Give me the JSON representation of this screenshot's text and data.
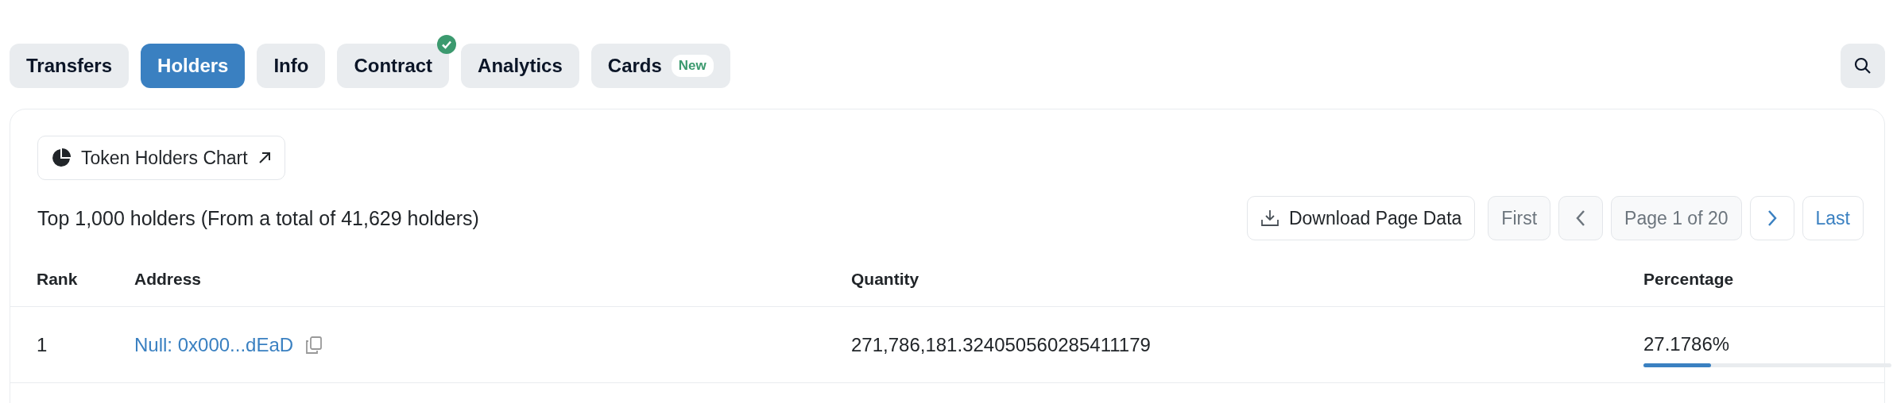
{
  "tabs": [
    {
      "label": "Transfers",
      "selected": false,
      "verified": false
    },
    {
      "label": "Holders",
      "selected": true,
      "verified": false
    },
    {
      "label": "Info",
      "selected": false,
      "verified": false
    },
    {
      "label": "Contract",
      "selected": false,
      "verified": true
    },
    {
      "label": "Analytics",
      "selected": false,
      "verified": false
    },
    {
      "label": "Cards",
      "selected": false,
      "verified": false,
      "badge": "New"
    }
  ],
  "chart_button": "Token Holders Chart",
  "summary": "Top 1,000 holders (From a total of 41,629 holders)",
  "download_button": "Download Page Data",
  "pagination": [
    {
      "kind": "text",
      "label": "First",
      "disabled": true
    },
    {
      "kind": "prev",
      "disabled": true
    },
    {
      "kind": "info",
      "label": "Page 1 of 20",
      "disabled": true
    },
    {
      "kind": "next",
      "disabled": false
    },
    {
      "kind": "text",
      "label": "Last",
      "disabled": false
    }
  ],
  "table": {
    "columns": [
      "Rank",
      "Address",
      "Quantity",
      "Percentage"
    ],
    "rows": [
      {
        "rank": "1",
        "address": "Null: 0x000...dEaD",
        "quantity": "271,786,181.324050560285411179",
        "percentage": "27.1786%",
        "level": 0.2718
      }
    ]
  }
}
